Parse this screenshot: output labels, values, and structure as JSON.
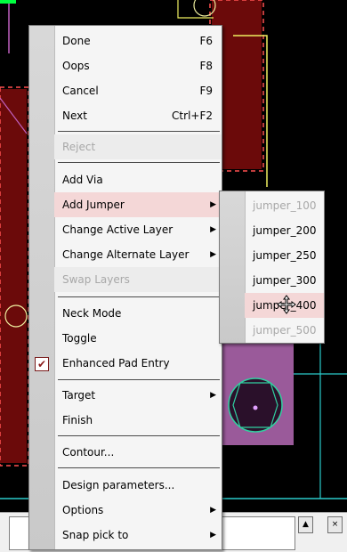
{
  "context_menu": {
    "items": [
      {
        "label": "Done",
        "shortcut": "F6",
        "disabled": false
      },
      {
        "label": "Oops",
        "shortcut": "F8",
        "disabled": false
      },
      {
        "label": "Cancel",
        "shortcut": "F9",
        "disabled": false
      },
      {
        "label": "Next",
        "shortcut": "Ctrl+F2",
        "disabled": false
      },
      {
        "label": "Reject",
        "disabled": true
      },
      {
        "label": "Add Via",
        "disabled": false
      },
      {
        "label": "Add Jumper",
        "submenu": true,
        "highlighted": true
      },
      {
        "label": "Change Active Layer",
        "submenu": true
      },
      {
        "label": "Change Alternate Layer",
        "submenu": true
      },
      {
        "label": "Swap Layers",
        "disabled": true
      },
      {
        "label": "Neck Mode"
      },
      {
        "label": "Toggle"
      },
      {
        "label": "Enhanced Pad Entry",
        "checked": true
      },
      {
        "label": "Target",
        "submenu": true
      },
      {
        "label": "Finish"
      },
      {
        "label": "Contour..."
      },
      {
        "label": "Design parameters..."
      },
      {
        "label": "Options",
        "submenu": true
      },
      {
        "label": "Snap pick to",
        "submenu": true
      }
    ]
  },
  "jumper_submenu": {
    "items": [
      {
        "label": "jumper_100",
        "disabled": true
      },
      {
        "label": "jumper_200"
      },
      {
        "label": "jumper_250"
      },
      {
        "label": "jumper_300"
      },
      {
        "label": "jumper_400",
        "highlighted": true
      },
      {
        "label": "jumper_500",
        "disabled": true
      }
    ]
  },
  "icons": {
    "submenu_arrow": "▶",
    "checkmark": "✔",
    "cursor": "move-cursor-icon"
  },
  "scrollbar": {
    "up": "▲",
    "close": "×"
  },
  "colors": {
    "highlight": "#f4d7d7",
    "pcb_background": "#000000",
    "copper": "#6b0a0a",
    "outline": "#f0f060",
    "pad": "#c070c0"
  }
}
